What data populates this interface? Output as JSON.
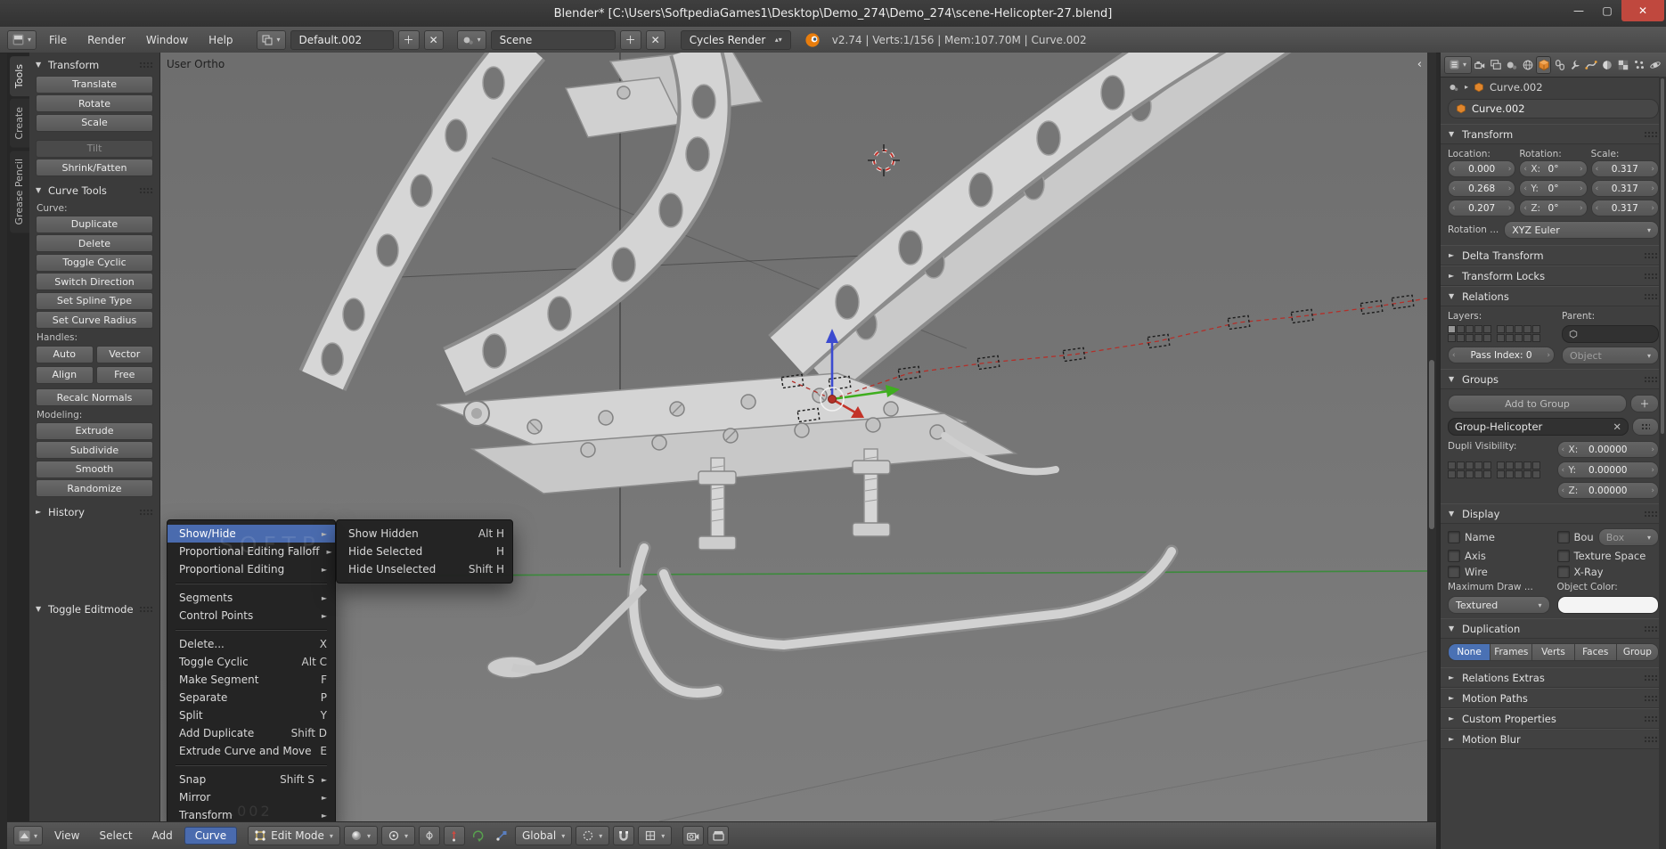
{
  "window": {
    "title": "Blender* [C:\\Users\\SoftpediaGames1\\Desktop\\Demo_274\\Demo_274\\scene-Helicopter-27.blend]"
  },
  "info_header": {
    "menus": [
      "File",
      "Render",
      "Window",
      "Help"
    ],
    "layout_name": "Default.002",
    "scene_name": "Scene",
    "engine": "Cycles Render",
    "stats": "v2.74 | Verts:1/156 | Mem:107.70M | Curve.002"
  },
  "shelf_tabs": [
    "Tools",
    "Create",
    "Grease Pencil"
  ],
  "tools": {
    "transform_title": "Transform",
    "translate": "Translate",
    "rotate": "Rotate",
    "scale": "Scale",
    "tilt": "Tilt",
    "shrink_fatten": "Shrink/Fatten",
    "curve_tools_title": "Curve Tools",
    "curve_label": "Curve:",
    "duplicate": "Duplicate",
    "delete": "Delete",
    "toggle_cyclic": "Toggle Cyclic",
    "switch_direction": "Switch Direction",
    "set_spline_type": "Set Spline Type",
    "set_curve_radius": "Set Curve Radius",
    "handles_label": "Handles:",
    "auto": "Auto",
    "vector": "Vector",
    "align": "Align",
    "free": "Free",
    "recalc_normals": "Recalc Normals",
    "modeling_label": "Modeling:",
    "extrude": "Extrude",
    "subdivide": "Subdivide",
    "smooth": "Smooth",
    "randomize": "Randomize",
    "history_title": "History",
    "toggle_editmode": "Toggle Editmode"
  },
  "viewport": {
    "view_label": "User Ortho",
    "watermark": "SOFTP",
    "watermark2": ".002"
  },
  "context_menu": {
    "items": [
      {
        "label": "Show/Hide"
      },
      {
        "label": "Proportional Editing Falloff"
      },
      {
        "label": "Proportional Editing"
      },
      {
        "label": "Segments"
      },
      {
        "label": "Control Points"
      },
      {
        "label": "Delete...",
        "shortcut": "X"
      },
      {
        "label": "Toggle Cyclic",
        "shortcut": "Alt C"
      },
      {
        "label": "Make Segment",
        "shortcut": "F"
      },
      {
        "label": "Separate",
        "shortcut": "P"
      },
      {
        "label": "Split",
        "shortcut": "Y"
      },
      {
        "label": "Add Duplicate",
        "shortcut": "Shift D"
      },
      {
        "label": "Extrude Curve and Move",
        "shortcut": "E"
      },
      {
        "label": "Snap",
        "shortcut": "Shift S"
      },
      {
        "label": "Mirror"
      },
      {
        "label": "Transform"
      }
    ],
    "submenu": [
      {
        "label": "Show Hidden",
        "shortcut": "Alt H"
      },
      {
        "label": "Hide Selected",
        "shortcut": "H"
      },
      {
        "label": "Hide Unselected",
        "shortcut": "Shift H"
      }
    ]
  },
  "view_header": {
    "view": "View",
    "select": "Select",
    "add": "Add",
    "curve": "Curve",
    "mode": "Edit Mode",
    "orientation": "Global"
  },
  "properties": {
    "breadcrumb": "Curve.002",
    "name": "Curve.002",
    "transform": {
      "title": "Transform",
      "location_label": "Location:",
      "rotation_label": "Rotation:",
      "scale_label": "Scale:",
      "loc": [
        "0.000",
        "0.268",
        "0.207"
      ],
      "rot_labels": [
        "X:",
        "Y:",
        "Z:"
      ],
      "rot": [
        "0°",
        "0°",
        "0°"
      ],
      "scl": [
        "0.317",
        "0.317",
        "0.317"
      ],
      "rotation_mode_label": "Rotation ...",
      "rotation_mode": "XYZ Euler"
    },
    "delta_transform_title": "Delta Transform",
    "transform_locks_title": "Transform Locks",
    "relations": {
      "title": "Relations",
      "layers_label": "Layers:",
      "parent_label": "Parent:",
      "parent_type": "Object",
      "pass_index_label": "Pass Index:",
      "pass_index": "0"
    },
    "groups": {
      "title": "Groups",
      "add_button": "Add to Group",
      "group_name": "Group-Helicopter",
      "dupli_label": "Dupli Visibility:",
      "offset_labels": [
        "X:",
        "Y:",
        "Z:"
      ],
      "offsets": [
        "0.00000",
        "0.00000",
        "0.00000"
      ]
    },
    "display": {
      "title": "Display",
      "cb_name": "Name",
      "cb_bounds": "Bou",
      "bounds_type": "Box",
      "cb_axis": "Axis",
      "cb_texspace": "Texture Space",
      "cb_wire": "Wire",
      "cb_xray": "X-Ray",
      "max_draw_label": "Maximum Draw ...",
      "object_color_label": "Object Color:",
      "draw_type": "Textured"
    },
    "duplication": {
      "title": "Duplication",
      "options": [
        "None",
        "Frames",
        "Verts",
        "Faces",
        "Group"
      ]
    },
    "relations_extras_title": "Relations Extras",
    "motion_paths_title": "Motion Paths",
    "custom_properties_title": "Custom Properties",
    "motion_blur_title": "Motion Blur"
  }
}
